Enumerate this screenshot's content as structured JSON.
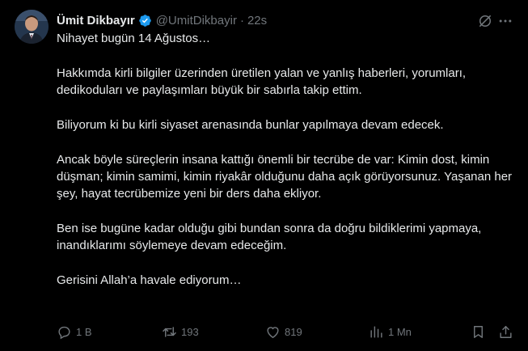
{
  "author": {
    "name": "Ümit Dikbayır",
    "handle": "@UmitDikbayir",
    "separator": "·",
    "time": "22s"
  },
  "tweet": {
    "paragraphs": [
      "Nihayet bugün 14 Ağustos…",
      "Hakkımda kirli bilgiler üzerinden üretilen yalan ve yanlış haberleri, yorumları, dedikoduları ve paylaşımları büyük bir sabırla takip ettim.",
      "Biliyorum ki bu kirli siyaset arenasında bunlar yapılmaya devam edecek.",
      "Ancak böyle süreçlerin insana kattığı önemli bir tecrübe de var: Kimin dost, kimin düşman; kimin samimi, kimin riyakâr olduğunu daha açık görüyorsunuz. Yaşanan her şey, hayat tecrübemize yeni bir ders daha ekliyor.",
      "Ben ise bugüne kadar olduğu gibi bundan sonra da doğru bildiklerimi yapmaya, inandıklarımı söylemeye devam edeceğim.",
      "Gerisini Allah’a havale ediyorum…"
    ]
  },
  "actions": {
    "replies": "1 B",
    "reposts": "193",
    "likes": "819",
    "views": "1 Mn"
  },
  "colors": {
    "background": "#000000",
    "text": "#e7e9ea",
    "muted": "#71767b",
    "verified": "#1d9bf0"
  },
  "icons": [
    "verified-badge-icon",
    "grok-icon",
    "more-icon",
    "reply-icon",
    "repost-icon",
    "like-icon",
    "views-icon",
    "bookmark-icon",
    "share-icon"
  ]
}
